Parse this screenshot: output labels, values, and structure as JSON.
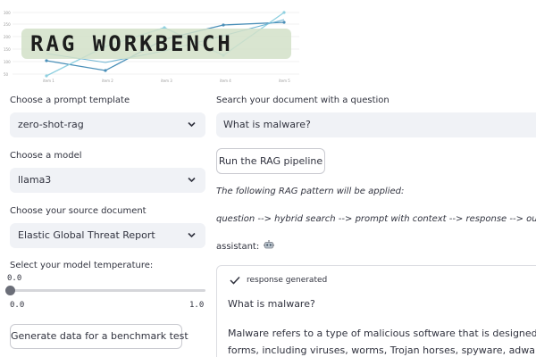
{
  "banner": {
    "title": "RAG WORKBENCH",
    "x_tick_labels": [
      "item 1",
      "item 2",
      "item 3",
      "item 4",
      "item 5"
    ],
    "y_tick_labels": [
      "300",
      "250",
      "200",
      "150",
      "100",
      "50",
      "0"
    ]
  },
  "sidebar": {
    "prompt_template": {
      "label": "Choose a prompt template",
      "value": "zero-shot-rag"
    },
    "model": {
      "label": "Choose a model",
      "value": "llama3"
    },
    "source_document": {
      "label": "Choose your source document",
      "value": "Elastic Global Threat Report"
    },
    "temperature": {
      "label": "Select your model temperature:",
      "value": "0.0",
      "min": "0.0",
      "max": "1.0",
      "level": 0.0
    },
    "benchmark_button": "Generate data for a benchmark test"
  },
  "main": {
    "search_label": "Search your document with a question",
    "search_value": "What is malware?",
    "run_button": "Run the RAG pipeline",
    "pattern_intro": "The following RAG pattern will be applied:",
    "pattern": "question --> hybrid search --> prompt with context --> response --> output",
    "assistant_label": "assistant:",
    "response": {
      "status": "response generated",
      "question": "What is malware?",
      "line1": "Malware refers to a type of malicious software that is designed to harm",
      "line2": "forms, including viruses, worms, Trojan horses, spyware, adware, and r"
    }
  },
  "colors": {
    "input_bg": "#f0f2f6",
    "text": "#31333f",
    "banner_line_dark": "#4a8fb8",
    "banner_line_light": "#8fd0e0"
  },
  "icons": {
    "select_chevron": "chevron-down-icon",
    "status_check": "check-icon",
    "assistant_avatar": "robot-icon"
  }
}
